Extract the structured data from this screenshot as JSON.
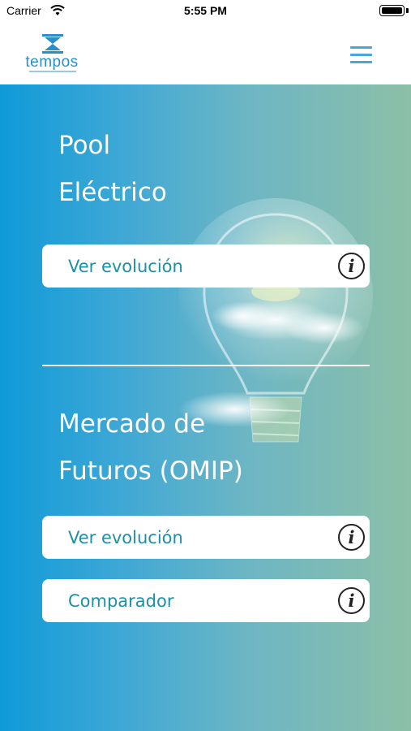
{
  "status_bar": {
    "carrier": "Carrier",
    "time": "5:55 PM"
  },
  "nav": {
    "logo_text": "tempos",
    "menu_icon": "hamburger-menu-icon"
  },
  "sections": [
    {
      "title_line1": "Pool",
      "title_line2": "Eléctrico",
      "buttons": [
        {
          "label": "Ver evolución",
          "icon": "info-icon"
        }
      ]
    },
    {
      "title_line1": "Mercado de",
      "title_line2": "Futuros (OMIP)",
      "buttons": [
        {
          "label": "Ver evolución",
          "icon": "info-icon"
        },
        {
          "label": "Comparador",
          "icon": "info-icon"
        }
      ]
    }
  ],
  "colors": {
    "brand_blue": "#2a8ec9",
    "menu_blue": "#49a5dc",
    "button_text": "#1f8fa6",
    "gradient_start": "#0f9ad8",
    "gradient_end": "#8cbfa7"
  }
}
